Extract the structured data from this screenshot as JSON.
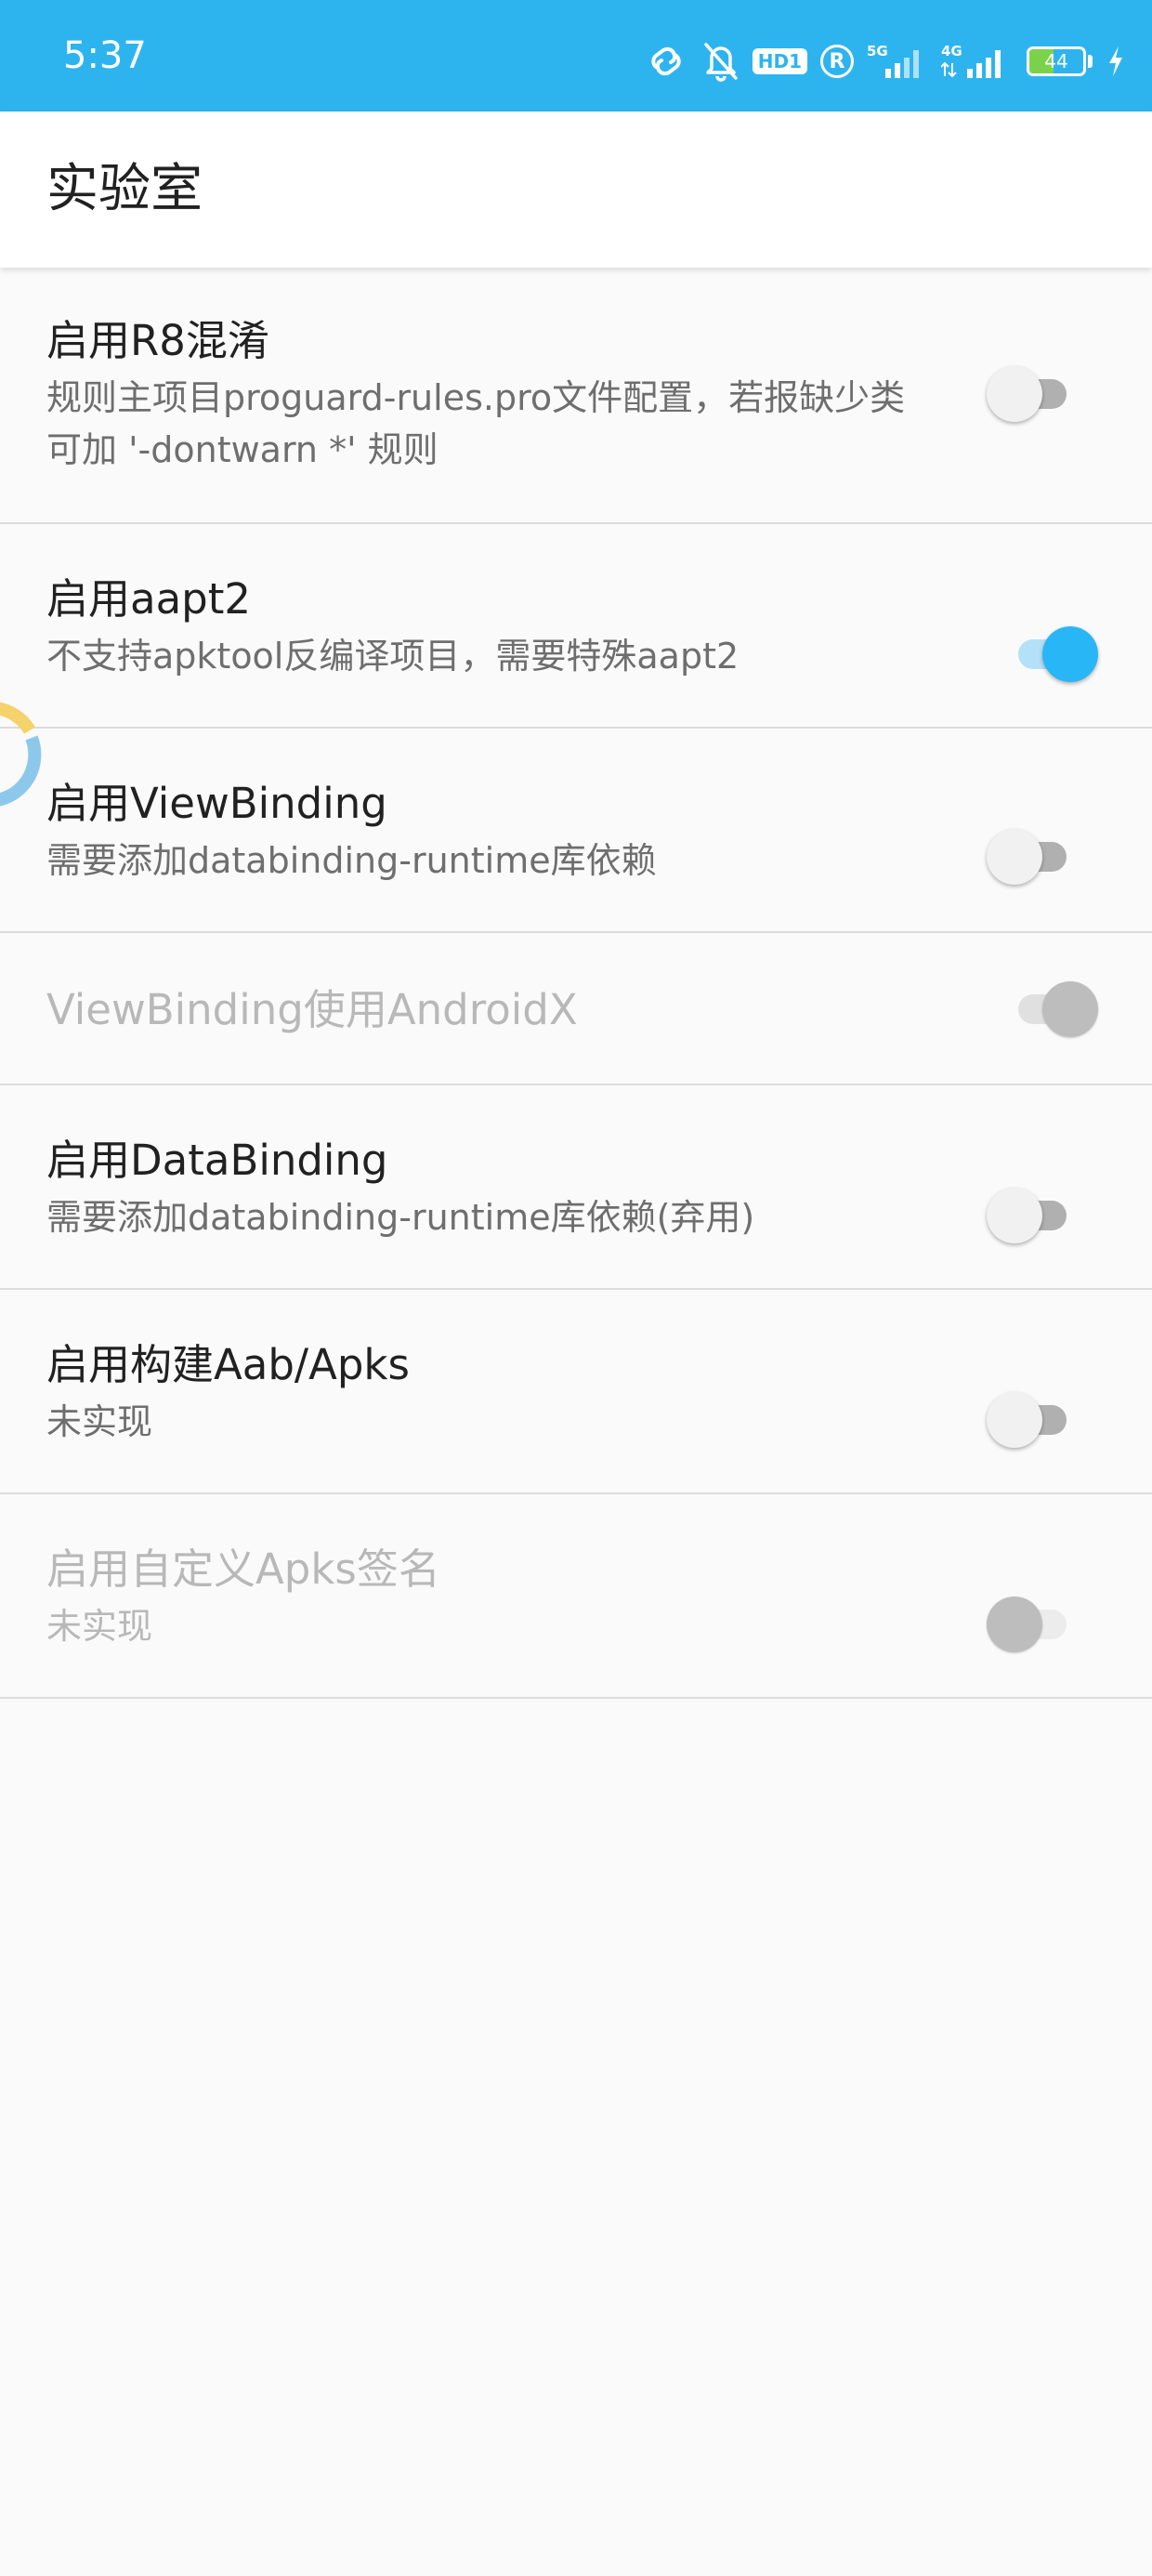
{
  "status_bar": {
    "time": "5:37",
    "icons": [
      "link-icon",
      "bell-off-icon",
      "hd-icon",
      "r-icon",
      "signal-5g-icon",
      "signal-4g-icon",
      "battery-icon",
      "charging-icon"
    ],
    "hd_label": "HD1",
    "r_label": "R",
    "network_5g": "5G",
    "network_4g": "4G",
    "battery_level": "44",
    "battery_fraction": 0.44,
    "background_color": "#2db4ef"
  },
  "app_bar": {
    "title": "实验室"
  },
  "settings": [
    {
      "title": "启用R8混淆",
      "summary": "规则主项目proguard-rules.pro文件配置，若报缺少类可加 '-dontwarn *' 规则",
      "checked": false,
      "enabled": true
    },
    {
      "title": "启用aapt2",
      "summary": "不支持apktool反编译项目，需要特殊aapt2",
      "checked": true,
      "enabled": true
    },
    {
      "title": "启用ViewBinding",
      "summary": "需要添加databinding-runtime库依赖",
      "checked": false,
      "enabled": true
    },
    {
      "title": "ViewBinding使用AndroidX",
      "summary": "",
      "checked": true,
      "enabled": false
    },
    {
      "title": "启用DataBinding",
      "summary": "需要添加databinding-runtime库依赖(弃用)",
      "checked": false,
      "enabled": true
    },
    {
      "title": "启用构建Aab/Apks",
      "summary": "未实现",
      "checked": false,
      "enabled": true
    },
    {
      "title": "启用自定义Apks签名",
      "summary": "未实现",
      "checked": false,
      "enabled": false
    }
  ],
  "colors": {
    "accent": "#29b6f6",
    "status_bar": "#2db4ef",
    "background": "#fafafa"
  }
}
